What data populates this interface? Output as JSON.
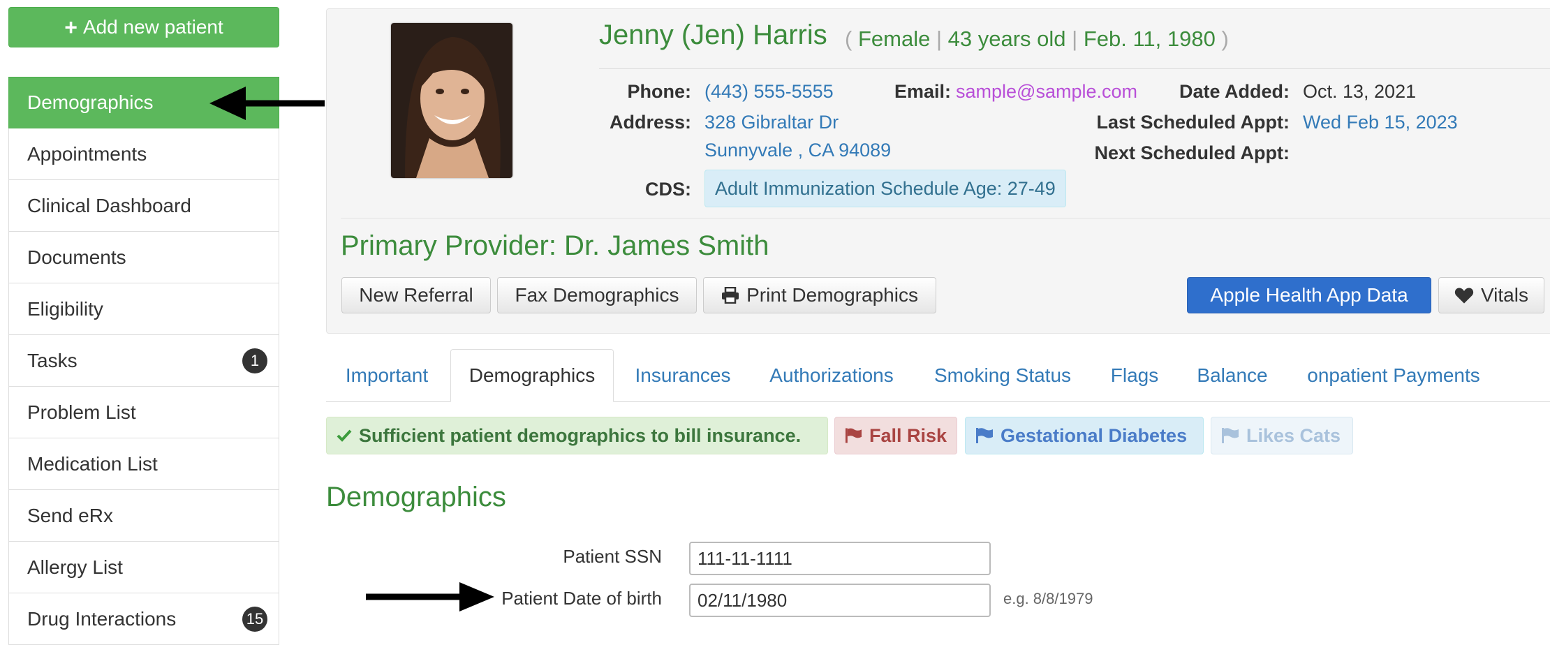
{
  "sidebar": {
    "add_button": "Add new patient",
    "items": [
      {
        "label": "Demographics",
        "active": true
      },
      {
        "label": "Appointments"
      },
      {
        "label": "Clinical Dashboard"
      },
      {
        "label": "Documents"
      },
      {
        "label": "Eligibility"
      },
      {
        "label": "Tasks",
        "badge": "1"
      },
      {
        "label": "Problem List"
      },
      {
        "label": "Medication List"
      },
      {
        "label": "Send eRx"
      },
      {
        "label": "Allergy List"
      },
      {
        "label": "Drug Interactions",
        "badge": "15"
      }
    ]
  },
  "patient": {
    "name": "Jenny (Jen) Harris",
    "gender": "Female",
    "age": "43 years old",
    "dob": "Feb. 11, 1980",
    "labels": {
      "phone": "Phone:",
      "email": "Email:",
      "date_added": "Date Added:",
      "address": "Address:",
      "last_appt": "Last Scheduled Appt:",
      "next_appt": "Next Scheduled Appt:",
      "cds": "CDS:"
    },
    "phone": "(443) 555-5555",
    "email": "sample@sample.com",
    "date_added": "Oct. 13, 2021",
    "address_line1": "328 Gibraltar Dr",
    "address_line2": "Sunnyvale , CA 94089",
    "last_appt": "Wed Feb 15, 2023",
    "next_appt": "",
    "cds": "Adult Immunization Schedule Age: 27-49"
  },
  "provider": "Primary Provider: Dr. James Smith",
  "actions": {
    "new_referral": "New Referral",
    "fax_demographics": "Fax Demographics",
    "print_demographics": "Print Demographics",
    "apple_health": "Apple Health App Data",
    "vitals": "Vitals"
  },
  "tabs": [
    {
      "label": "Important"
    },
    {
      "label": "Demographics",
      "active": true
    },
    {
      "label": "Insurances"
    },
    {
      "label": "Authorizations"
    },
    {
      "label": "Smoking Status"
    },
    {
      "label": "Flags"
    },
    {
      "label": "Balance"
    },
    {
      "label": "onpatient Payments"
    }
  ],
  "alerts": {
    "sufficient": "Sufficient patient demographics to bill insurance.",
    "flag1": "Fall Risk",
    "flag2": "Gestational Diabetes",
    "flag3": "Likes Cats"
  },
  "section_title": "Demographics",
  "form": {
    "ssn_label": "Patient SSN",
    "ssn_value": "111-11-1111",
    "dob_label": "Patient Date of birth",
    "dob_value": "02/11/1980",
    "dob_hint": "e.g. 8/8/1979"
  },
  "colors": {
    "green": "#5cb85c",
    "title_green": "#3c8c3c",
    "link_blue": "#337ab7",
    "primary_blue": "#2f6fcc",
    "email_purple": "#b84fd8"
  }
}
